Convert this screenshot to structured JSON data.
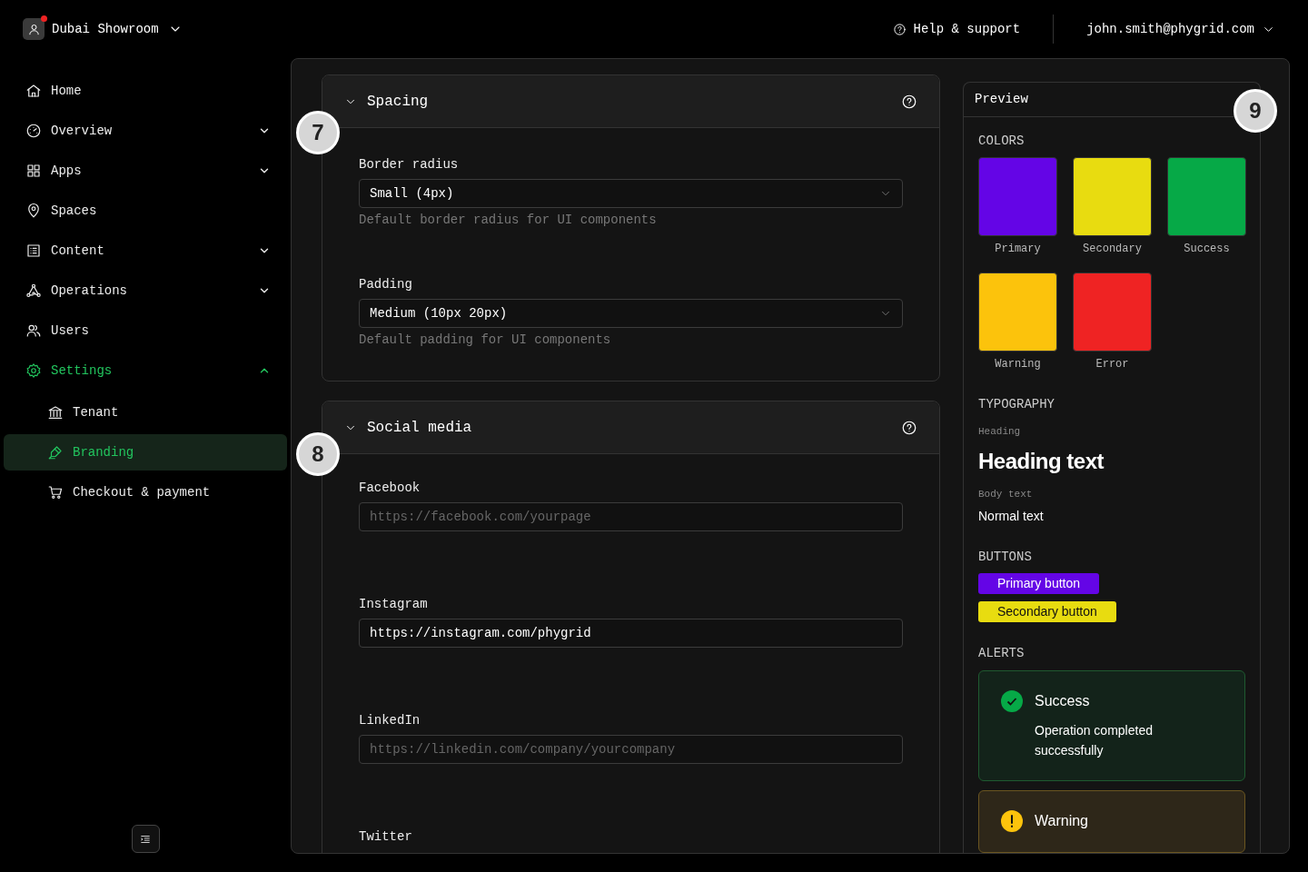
{
  "workspace": {
    "name": "Dubai Showroom",
    "notification": true
  },
  "header": {
    "help": "Help & support",
    "user": "john.smith@phygrid.com"
  },
  "sidebar": {
    "items": [
      {
        "kind": "home",
        "label": "Home",
        "selected": false
      },
      {
        "kind": "gauge",
        "label": "Overview",
        "expanded": false,
        "selected": false
      },
      {
        "kind": "grid",
        "label": "Apps",
        "expanded": false,
        "selected": false
      },
      {
        "kind": "pin",
        "label": "Spaces",
        "selected": false
      },
      {
        "kind": "list",
        "label": "Content",
        "expanded": false,
        "selected": false
      },
      {
        "kind": "nodes",
        "label": "Operations",
        "expanded": false,
        "selected": false
      },
      {
        "kind": "users",
        "label": "Users",
        "selected": false
      },
      {
        "kind": "gear",
        "label": "Settings",
        "expanded": true,
        "selected": true,
        "children": [
          {
            "kind": "bank",
            "label": "Tenant",
            "selected": false
          },
          {
            "kind": "pen",
            "label": "Branding",
            "selected": true
          },
          {
            "kind": "cart",
            "label": "Checkout & payment",
            "selected": false
          }
        ]
      }
    ]
  },
  "sections": [
    {
      "title": "Spacing",
      "badge": "7",
      "expanded": true,
      "fields": [
        {
          "kind": "select",
          "label": "Border radius",
          "value": "Small (4px)",
          "hint": "Default border radius for UI components"
        },
        {
          "kind": "select",
          "label": "Padding",
          "value": "Medium (10px 20px)",
          "hint": "Default padding for UI components"
        }
      ]
    },
    {
      "title": "Social media",
      "badge": "8",
      "expanded": true,
      "fields": [
        {
          "kind": "input",
          "label": "Facebook",
          "placeholder": "https://facebook.com/yourpage"
        },
        {
          "kind": "input",
          "label": "Instagram",
          "value": "https://instagram.com/phygrid"
        },
        {
          "kind": "input",
          "label": "LinkedIn",
          "placeholder": "https://linkedin.com/company/yourcompany"
        },
        {
          "kind": "input",
          "label": "Twitter"
        }
      ]
    }
  ],
  "preview": {
    "title": "Preview",
    "badge": "9",
    "colors": {
      "heading": "COLORS",
      "swatches": [
        {
          "label": "Primary",
          "color": "#6405e6"
        },
        {
          "label": "Secondary",
          "color": "#e8dc10"
        },
        {
          "label": "Success",
          "color": "#06a947"
        },
        {
          "label": "Warning",
          "color": "#fcc30c"
        },
        {
          "label": "Error",
          "color": "#ef2323"
        }
      ]
    },
    "typography": {
      "heading": "TYPOGRAPHY",
      "items": [
        {
          "kind": "heading",
          "label": "Heading",
          "sample": "Heading text"
        },
        {
          "kind": "body",
          "label": "Body text",
          "sample": "Normal text"
        }
      ]
    },
    "buttons": {
      "heading": "BUTTONS",
      "items": [
        {
          "kind": "primary",
          "label": "Primary button"
        },
        {
          "kind": "secondary",
          "label": "Secondary button"
        }
      ]
    },
    "alerts": {
      "heading": "ALERTS",
      "items": [
        {
          "kind": "success",
          "title": "Success",
          "message": "Operation completed successfully"
        },
        {
          "kind": "warning",
          "title": "Warning"
        }
      ]
    }
  }
}
